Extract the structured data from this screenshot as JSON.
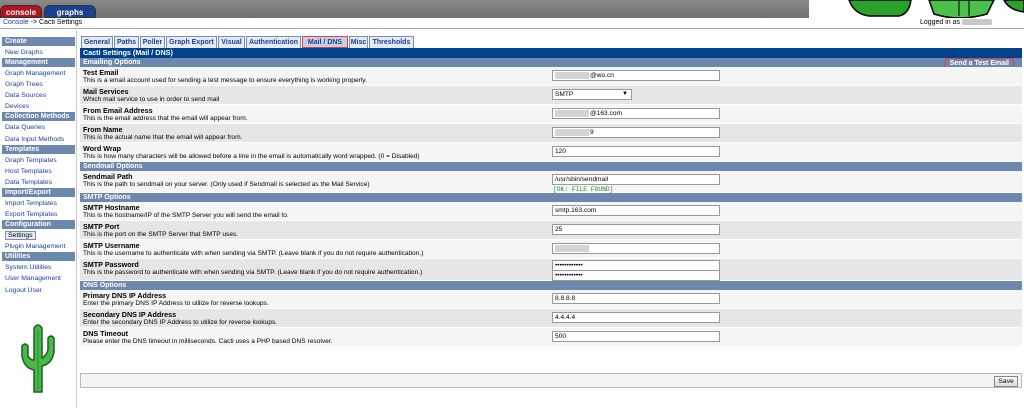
{
  "top_tabs": {
    "console": "console",
    "graphs": "graphs"
  },
  "breadcrumb": {
    "root": "Console",
    "sep": " -> ",
    "current": "Cacti Settings"
  },
  "login": {
    "prefix": "Logged in as "
  },
  "menu": [
    {
      "type": "head",
      "label": "Create"
    },
    {
      "type": "item",
      "label": "New Graphs"
    },
    {
      "type": "head",
      "label": "Management"
    },
    {
      "type": "item",
      "label": "Graph Management"
    },
    {
      "type": "item",
      "label": "Graph Trees"
    },
    {
      "type": "item",
      "label": "Data Sources"
    },
    {
      "type": "item",
      "label": "Devices"
    },
    {
      "type": "head",
      "label": "Collection Methods"
    },
    {
      "type": "item",
      "label": "Data Queries"
    },
    {
      "type": "item",
      "label": "Data Input Methods"
    },
    {
      "type": "head",
      "label": "Templates"
    },
    {
      "type": "item",
      "label": "Graph Templates"
    },
    {
      "type": "item",
      "label": "Host Templates"
    },
    {
      "type": "item",
      "label": "Data Templates"
    },
    {
      "type": "head",
      "label": "Import/Export"
    },
    {
      "type": "item",
      "label": "Import Templates"
    },
    {
      "type": "item",
      "label": "Export Templates"
    },
    {
      "type": "head",
      "label": "Configuration"
    },
    {
      "type": "item",
      "label": "Settings",
      "selected": true
    },
    {
      "type": "item",
      "label": "Plugin Management"
    },
    {
      "type": "head",
      "label": "Utilities"
    },
    {
      "type": "item",
      "label": "System Utilities"
    },
    {
      "type": "item",
      "label": "User Management"
    },
    {
      "type": "item",
      "label": "Logout User"
    }
  ],
  "tabs": [
    {
      "label": "General"
    },
    {
      "label": "Paths"
    },
    {
      "label": "Poller"
    },
    {
      "label": "Graph Export"
    },
    {
      "label": "Visual"
    },
    {
      "label": "Authentication"
    },
    {
      "label": "Mail / DNS",
      "active": true
    },
    {
      "label": "Misc"
    },
    {
      "label": "Thresholds"
    }
  ],
  "panel_title": "Cacti Settings (Mail / DNS)",
  "test_email_label": "Send a Test Email",
  "sections": [
    {
      "title": "Emailing Options",
      "rows": [
        {
          "label": "Test Email",
          "desc": "This is a email account used for sending a test message to ensure everything is working properly.",
          "value": "@wo.cn",
          "masked": true
        },
        {
          "label": "Mail Services",
          "desc": "Which mail service to use in order to send mail",
          "select": "SMTP"
        },
        {
          "label": "From Email Address",
          "desc": "This is the email address that the email will appear from.",
          "value": "@163.com",
          "masked": true
        },
        {
          "label": "From Name",
          "desc": "This is the actual name that the email will appear from.",
          "value": "9",
          "masked": true
        },
        {
          "label": "Word Wrap",
          "desc": "This is how many characters will be allowed before a line in the email is automatically word wrapped. (0 = Disabled)",
          "value": "120"
        }
      ]
    },
    {
      "title": "Sendmail Options",
      "rows": [
        {
          "label": "Sendmail Path",
          "desc": "This is the path to sendmail on your server. (Only used if Sendmail is selected as the Mail Service)",
          "value": "/usr/sbin/sendmail",
          "note": "[OK: FILE FOUND]"
        }
      ]
    },
    {
      "title": "SMTP Options",
      "rows": [
        {
          "label": "SMTP Hostname",
          "desc": "This is the hostname/IP of the SMTP Server you will send the email to.",
          "value": "smtp.163.com"
        },
        {
          "label": "SMTP Port",
          "desc": "This is the port on the SMTP Server that SMTP uses.",
          "value": "25"
        },
        {
          "label": "SMTP Username",
          "desc": "This is the username to authenticate with when sending via SMTP. (Leave blank if you do not require authentication.)",
          "value": "",
          "masked": true
        },
        {
          "label": "SMTP Password",
          "desc": "This is the password to authenticate with when sending via SMTP. (Leave blank if you do not require authentication.)",
          "value": "••••••••••••",
          "value2": "••••••••••••"
        }
      ]
    },
    {
      "title": "DNS Options",
      "rows": [
        {
          "label": "Primary DNS IP Address",
          "desc": "Enter the primary DNS IP Address to utilize for reverse lookups.",
          "value": "8.8.8.8"
        },
        {
          "label": "Secondary DNS IP Address",
          "desc": "Enter the secondary DNS IP Address to utilize for reverse lookups.",
          "value": "4.4.4.4"
        },
        {
          "label": "DNS Timeout",
          "desc": "Please enter the DNS timeout in milliseconds. Cacti uses a PHP based DNS resolver.",
          "value": "500"
        }
      ]
    }
  ],
  "save_label": "Save"
}
